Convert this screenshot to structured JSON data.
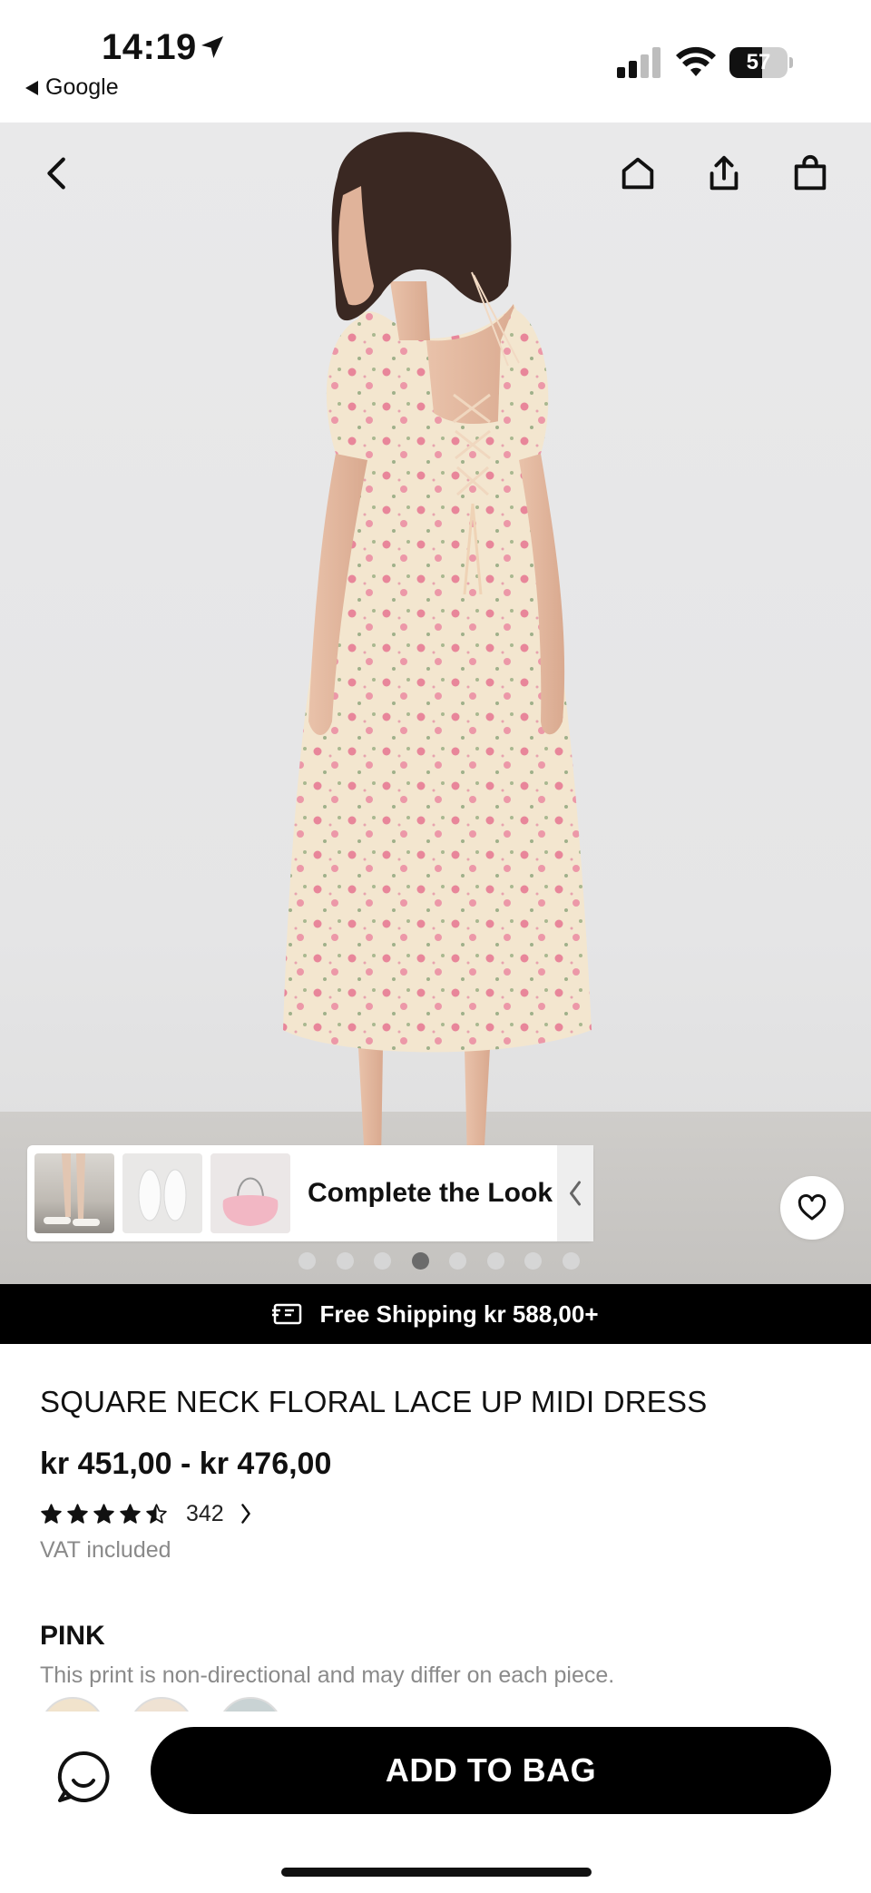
{
  "status_bar": {
    "time": "14:19",
    "back_app": "Google",
    "battery": "57",
    "battery_level": 0.57
  },
  "hero": {
    "image_count": 8,
    "active_index": 3,
    "icons": {
      "back": "chevron-left-icon",
      "home": "home-icon",
      "share": "share-icon",
      "bag": "shopping-bag-icon",
      "wishlist": "heart-icon"
    }
  },
  "complete_the_look": {
    "label": "Complete the Look"
  },
  "shipping": {
    "text": "Free Shipping kr 588,00+"
  },
  "product": {
    "title": "SQUARE NECK FLORAL LACE UP MIDI DRESS",
    "price": "kr 451,00 - kr 476,00",
    "rating": 4.5,
    "review_count": "342",
    "vat": "VAT included",
    "color_name": "PINK",
    "print_note": "This print is non-directional and may differ on each piece."
  },
  "actions": {
    "add_to_bag": "ADD TO BAG"
  },
  "colors": {
    "black": "#000000",
    "muted_text": "#8a8a8a",
    "dress_base": "#f3e6cf",
    "floral_pink": "#e57c8f"
  }
}
